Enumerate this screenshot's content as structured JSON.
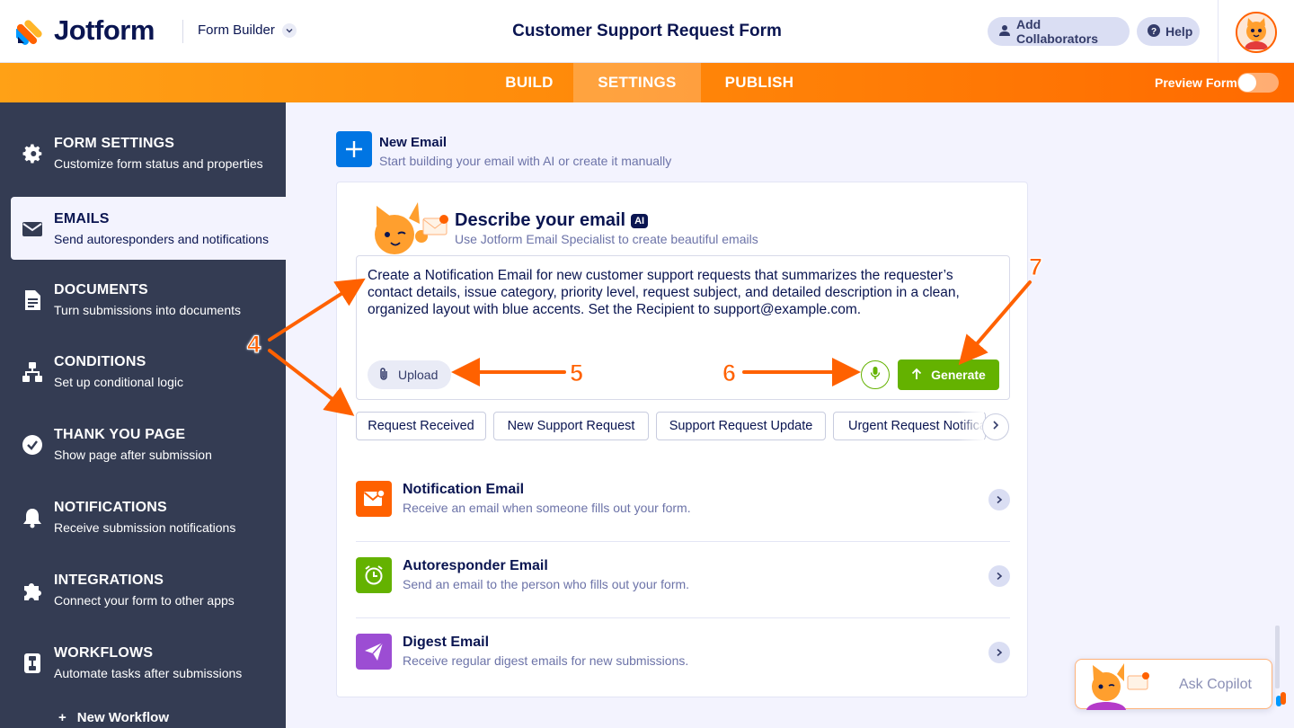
{
  "header": {
    "brand": "Jotform",
    "builder_label": "Form Builder",
    "form_title": "Customer Support Request Form",
    "add_collaborators": "Add Collaborators",
    "help": "Help"
  },
  "nav": {
    "tabs": [
      {
        "label": "BUILD"
      },
      {
        "label": "SETTINGS",
        "active": true
      },
      {
        "label": "PUBLISH"
      }
    ],
    "preview_label": "Preview Form",
    "preview_on": false
  },
  "sidebar": {
    "items": [
      {
        "title": "FORM SETTINGS",
        "subtitle": "Customize form status and properties",
        "icon": "gear-icon"
      },
      {
        "title": "EMAILS",
        "subtitle": "Send autoresponders and notifications",
        "icon": "envelope-icon",
        "active": true
      },
      {
        "title": "DOCUMENTS",
        "subtitle": "Turn submissions into documents",
        "icon": "document-icon"
      },
      {
        "title": "CONDITIONS",
        "subtitle": "Set up conditional logic",
        "icon": "sitemap-icon"
      },
      {
        "title": "THANK YOU PAGE",
        "subtitle": "Show page after submission",
        "icon": "check-circle-icon"
      },
      {
        "title": "NOTIFICATIONS",
        "subtitle": "Receive submission notifications",
        "icon": "bell-icon"
      },
      {
        "title": "INTEGRATIONS",
        "subtitle": "Connect your form to other apps",
        "icon": "puzzle-icon"
      },
      {
        "title": "WORKFLOWS",
        "subtitle": "Automate tasks after submissions",
        "icon": "workflow-icon"
      }
    ],
    "new_workflow": "New Workflow"
  },
  "main": {
    "new_email": {
      "title": "New Email",
      "subtitle": "Start building your email with AI or create it manually"
    },
    "describe": {
      "title": "Describe your email",
      "ai_badge": "AI",
      "subtitle": "Use Jotform Email Specialist to create beautiful emails",
      "prompt": "Create a Notification Email for new customer support requests that summarizes the requester’s contact details, issue category, priority level, request subject, and detailed description in a clean, organized layout with blue accents. Set the Recipient to support@example.com.",
      "upload": "Upload",
      "generate": "Generate"
    },
    "chips": [
      "Request Received",
      "New Support Request",
      "Support Request Update",
      "Urgent Request Notification"
    ],
    "email_types": [
      {
        "title": "Notification Email",
        "subtitle": "Receive an email when someone fills out your form.",
        "color": "#ff6100",
        "icon": "notification-envelope-icon"
      },
      {
        "title": "Autoresponder Email",
        "subtitle": "Send an email to the person who fills out your form.",
        "color": "#64b200",
        "icon": "alarm-clock-icon"
      },
      {
        "title": "Digest Email",
        "subtitle": "Receive regular digest emails for new submissions.",
        "color": "#9c4dd3",
        "icon": "paper-plane-icon"
      }
    ]
  },
  "copilot": {
    "label": "Ask Copilot"
  },
  "annotations": [
    "4",
    "5",
    "6",
    "7"
  ],
  "colors": {
    "orange": "#ff6100",
    "green": "#64b200",
    "blue": "#0075e3",
    "purple": "#9c4dd3",
    "navy": "#0a1551",
    "sidebar": "#343c53"
  }
}
